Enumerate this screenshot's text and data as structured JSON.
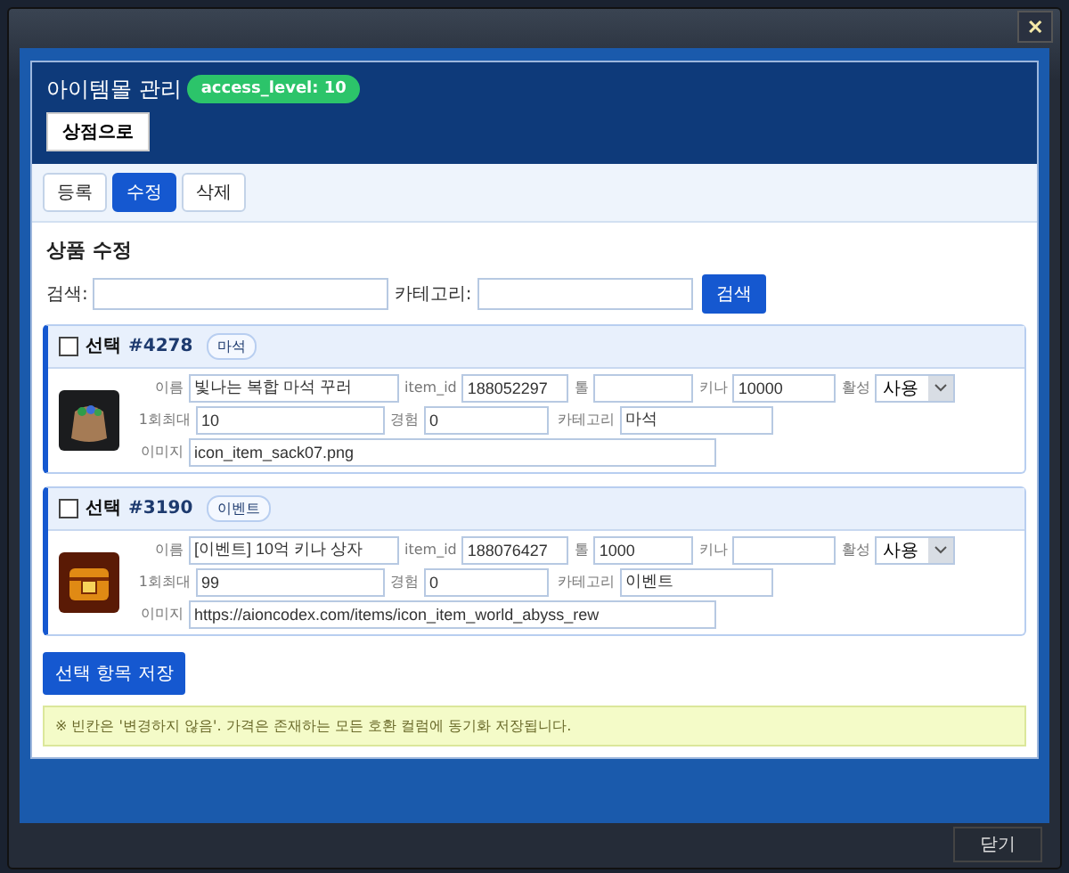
{
  "window": {
    "close_glyph": "✕",
    "footer_button": "닫기"
  },
  "header": {
    "title": "아이템몰 관리",
    "badge": "access_level: 10",
    "back_button": "상점으로"
  },
  "tabs": [
    {
      "label": "등록",
      "selected": false
    },
    {
      "label": "수정",
      "selected": true
    },
    {
      "label": "삭제",
      "selected": false
    }
  ],
  "section_title": "상품 수정",
  "search": {
    "label": "검색:",
    "category_label": "카테고리:",
    "button": "검색"
  },
  "items": [
    {
      "checked": false,
      "select_label": "선택",
      "id": "#4278",
      "tag": "마석",
      "rows": [
        [
          {
            "label": "이름",
            "value": "빛나는 복합 마석 꾸러",
            "kind": "text"
          },
          {
            "label": "item_id",
            "value": "188052297",
            "kind": "text"
          },
          {
            "label": "톨",
            "kind": "text"
          },
          {
            "label": "키나",
            "value": "10000",
            "kind": "text"
          },
          {
            "label": "활성",
            "value": "사용",
            "kind": "select"
          }
        ],
        [
          {
            "label": "1회최대",
            "value": "10",
            "kind": "text"
          },
          {
            "label": "경험",
            "value": "0",
            "kind": "text"
          },
          {
            "label": "카테고리",
            "value": "마석",
            "kind": "text"
          }
        ],
        [
          {
            "label": "이미지",
            "value": "icon_item_sack07.png",
            "kind": "text"
          }
        ]
      ]
    },
    {
      "checked": false,
      "select_label": "선택",
      "id": "#3190",
      "tag": "이벤트",
      "rows": [
        [
          {
            "label": "이름",
            "value": "[이벤트] 10억 키나 상자",
            "kind": "text"
          },
          {
            "label": "item_id",
            "value": "188076427",
            "kind": "text"
          },
          {
            "label": "톨",
            "value": "1000",
            "kind": "text"
          },
          {
            "label": "키나",
            "kind": "text"
          },
          {
            "label": "활성",
            "value": "사용",
            "kind": "select"
          }
        ],
        [
          {
            "label": "1회최대",
            "value": "99",
            "kind": "text"
          },
          {
            "label": "경험",
            "value": "0",
            "kind": "text"
          },
          {
            "label": "카테고리",
            "value": "이벤트",
            "kind": "text"
          }
        ],
        [
          {
            "label": "이미지",
            "value": "https://aioncodex.com/items/icon_item_world_abyss_rew",
            "kind": "text"
          }
        ]
      ]
    }
  ],
  "save_button": "선택 항목 저장",
  "note": "※ 빈칸은 '변경하지 않음'. 가격은 존재하는 모든 호환 컬럼에 동기화 저장됩니다."
}
